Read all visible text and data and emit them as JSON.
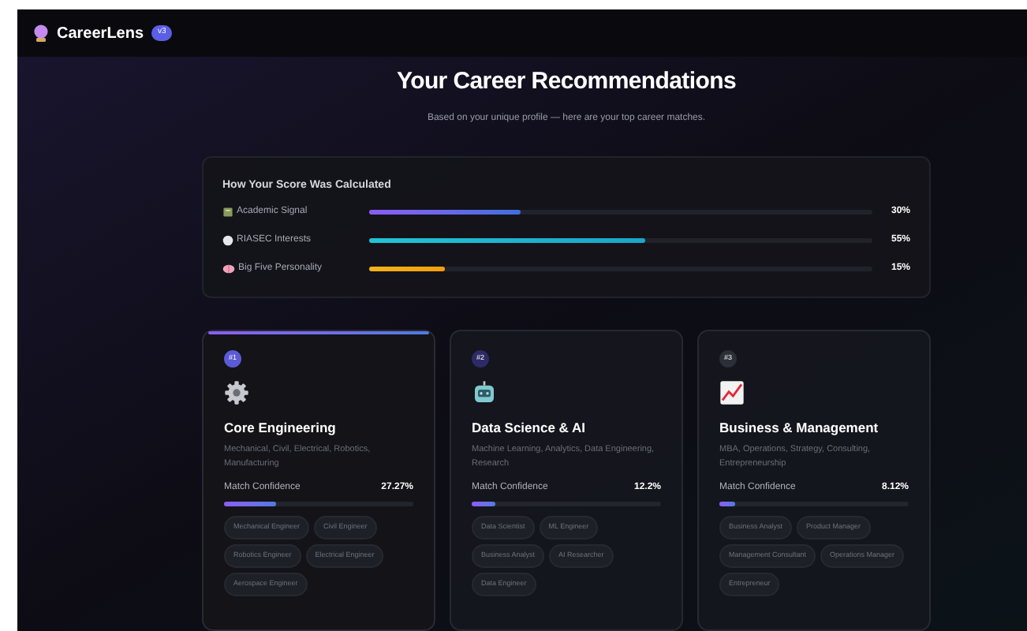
{
  "header": {
    "brand": "CareerLens",
    "version": "v3"
  },
  "title": "Your Career Recommendations",
  "subtitle": "Based on your unique profile — here are your top career matches.",
  "score": {
    "title": "How Your Score Was Calculated",
    "rows": [
      {
        "label": "Academic Signal",
        "kind": "book",
        "level": 0.3,
        "reading": "30%"
      },
      {
        "label": "RIASEC Interests",
        "kind": "dot",
        "level": 0.55,
        "reading": "55%"
      },
      {
        "label": "Big Five Personality",
        "kind": "brain",
        "level": 0.15,
        "reading": "15%"
      }
    ]
  },
  "cards": [
    {
      "rank": "#1",
      "color": "#5b5bd6",
      "highlighted": true,
      "kind": "gear",
      "title": "Core Engineering",
      "description": "Mechanical, Civil, Electrical, Robotics, Manufacturing",
      "confidence_label": "Match Confidence",
      "reading": "27.27%",
      "level": 0.2727,
      "tags": [
        "Mechanical Engineer",
        "Civil Engineer",
        "Robotics Engineer",
        "Electrical Engineer",
        "Aerospace Engineer"
      ]
    },
    {
      "rank": "#2",
      "color": "#2e2a66",
      "highlighted": false,
      "kind": "robot",
      "title": "Data Science & AI",
      "description": "Machine Learning, Analytics, Data Engineering, Research",
      "confidence_label": "Match Confidence",
      "reading": "12.2%",
      "level": 0.122,
      "tags": [
        "Data Scientist",
        "ML Engineer",
        "Business Analyst",
        "AI Researcher",
        "Data Engineer"
      ]
    },
    {
      "rank": "#3",
      "color": "#2a2f38",
      "highlighted": false,
      "kind": "chart",
      "title": "Business & Management",
      "description": "MBA, Operations, Strategy, Consulting, Entrepreneurship",
      "confidence_label": "Match Confidence",
      "reading": "8.12%",
      "level": 0.0812,
      "tags": [
        "Business Analyst",
        "Product Manager",
        "Management Consultant",
        "Operations Manager",
        "Entrepreneur"
      ]
    }
  ]
}
